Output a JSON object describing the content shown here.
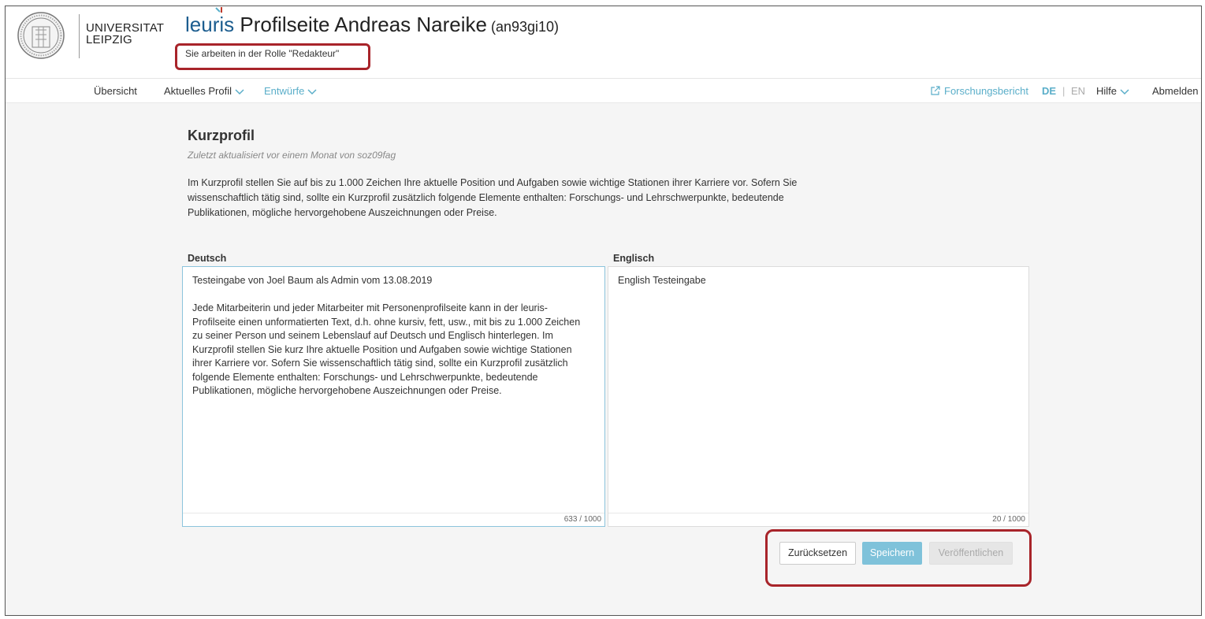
{
  "header": {
    "university_line1": "UNIVERSITAT",
    "university_line2": "LEIPZIG",
    "brand": "leuris",
    "page_title": " Profilseite Andreas Nareike",
    "user_id": " (an93gi10)",
    "role_note": "Sie arbeiten in der Rolle \"Redakteur\""
  },
  "nav": {
    "overview": "Übersicht",
    "current_profile": "Aktuelles Profil",
    "drafts": "Entwürfe",
    "research_report": "Forschungsbericht",
    "lang_de": "DE",
    "lang_sep": "|",
    "lang_en": "EN",
    "help": "Hilfe",
    "logout": "Abmelden"
  },
  "main": {
    "title": "Kurzprofil",
    "updated": "Zuletzt aktualisiert vor einem Monat von soz09fag",
    "intro": "Im Kurzprofil stellen Sie auf bis zu 1.000 Zeichen Ihre aktuelle Position und Aufgaben sowie wichtige Stationen ihrer Karriere vor. Sofern Sie wissenschaftlich tätig sind, sollte ein Kurzprofil zusätzlich folgende Elemente enthalten: Forschungs- und Lehrschwerpunkte, bedeutende Publikationen, mögliche hervorgehobene Auszeichnungen oder Preise.",
    "german": {
      "label": "Deutsch",
      "text": "Testeingabe von Joel Baum als Admin vom 13.08.2019\n\nJede Mitarbeiterin und jeder Mitarbeiter mit Personenprofilseite kann in der leuris-Profilseite einen unformatierten Text, d.h. ohne kursiv, fett, usw., mit bis zu 1.000 Zeichen zu seiner Person und seinem Lebenslauf auf Deutsch und Englisch hinterlegen. Im Kurzprofil stellen Sie kurz Ihre aktuelle Position und Aufgaben sowie wichtige Stationen ihrer Karriere vor. Sofern Sie wissenschaftlich tätig sind, sollte ein Kurzprofil zusätzlich folgende Elemente enthalten: Forschungs- und Lehrschwerpunkte, bedeutende Publikationen, mögliche hervorgehobene Auszeichnungen oder Preise.",
      "counter": "633 / 1000"
    },
    "english": {
      "label": "Englisch",
      "text": "English Testeingabe",
      "counter": "20 / 1000"
    },
    "buttons": {
      "reset": "Zurücksetzen",
      "save": "Speichern",
      "publish": "Veröffentlichen"
    }
  },
  "colors": {
    "accent": "#5aaec9",
    "brand_blue": "#1c5d8f",
    "highlight_red": "#a8242a",
    "save_button": "#7fc2da"
  },
  "icons": {
    "seal": "university-seal-icon",
    "external_link": "external-link-icon",
    "chevron": "chevron-down-icon"
  }
}
